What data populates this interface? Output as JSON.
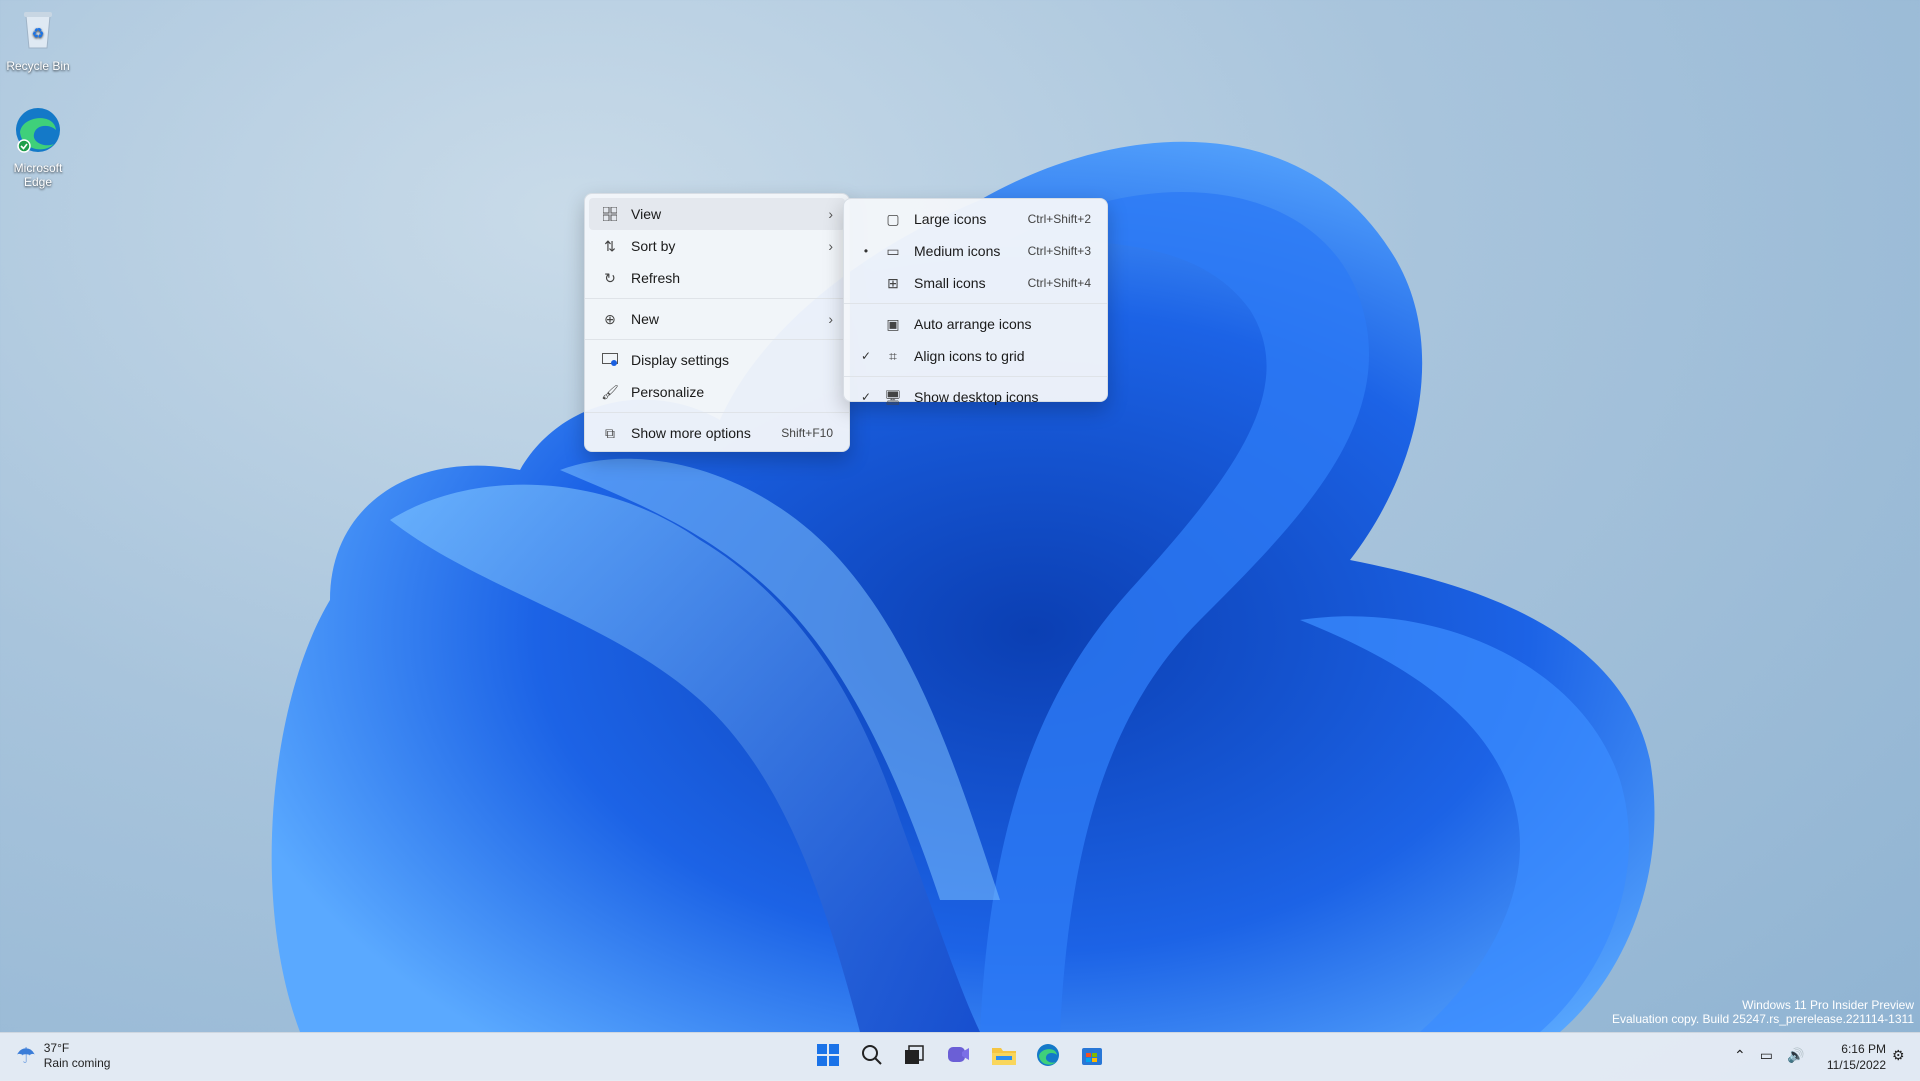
{
  "desktop": {
    "icons": [
      {
        "label": "Recycle Bin",
        "icon": "recycle-bin-icon"
      },
      {
        "label": "Microsoft Edge",
        "icon": "edge-icon"
      }
    ]
  },
  "context_menu": {
    "items": [
      {
        "label": "View",
        "icon": "grid-icon"
      },
      {
        "label": "Sort by",
        "icon": "sort-icon"
      },
      {
        "label": "Refresh",
        "icon": "refresh-icon"
      },
      {
        "label": "New",
        "icon": "plus-circle-icon"
      },
      {
        "label": "Display settings",
        "icon": "display-icon"
      },
      {
        "label": "Personalize",
        "icon": "brush-icon"
      },
      {
        "label": "Show more options",
        "shortcut": "Shift+F10",
        "icon": "open-external-icon"
      }
    ]
  },
  "view_submenu": {
    "items": [
      {
        "label": "Large icons",
        "shortcut": "Ctrl+Shift+2",
        "mark": ""
      },
      {
        "label": "Medium icons",
        "shortcut": "Ctrl+Shift+3",
        "mark": "•"
      },
      {
        "label": "Small icons",
        "shortcut": "Ctrl+Shift+4",
        "mark": ""
      },
      {
        "label": "Auto arrange icons",
        "mark": ""
      },
      {
        "label": "Align icons to grid",
        "mark": "✓"
      },
      {
        "label": "Show desktop icons",
        "mark": "✓"
      }
    ]
  },
  "taskbar": {
    "weather": {
      "temp": "37°F",
      "condition": "Rain coming"
    },
    "clock": {
      "time": "6:16 PM",
      "date": "11/15/2022"
    },
    "apps": [
      "start-icon",
      "search-icon",
      "task-view-icon",
      "chat-icon",
      "file-explorer-icon",
      "edge-icon",
      "store-icon"
    ]
  },
  "watermark": {
    "line1": "Windows 11 Pro Insider Preview",
    "line2": "Evaluation copy. Build 25247.rs_prerelease.221114-1311"
  },
  "colors": {
    "accent": "#1a5fe0",
    "bloom_dark": "#0a3aa8",
    "bloom_light": "#4fa3ff"
  }
}
